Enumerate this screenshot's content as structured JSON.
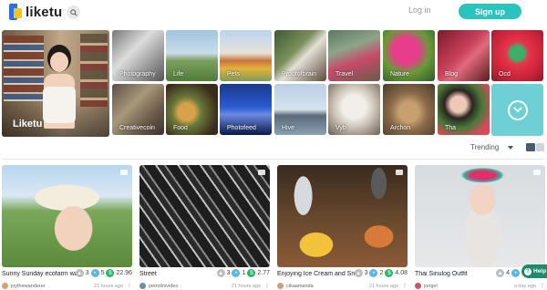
{
  "header": {
    "brand": "liketu",
    "login_label": "Log in",
    "signup_label": "Sign up"
  },
  "hero": {
    "label": "Liketu"
  },
  "categories": [
    {
      "label": "Photography"
    },
    {
      "label": "Life"
    },
    {
      "label": "Pets"
    },
    {
      "label": "Proofofbrain"
    },
    {
      "label": "Travel"
    },
    {
      "label": "Nature"
    },
    {
      "label": "Blog"
    },
    {
      "label": "Ocd"
    },
    {
      "label": "Creativecoin"
    },
    {
      "label": "Food"
    },
    {
      "label": "Photofeed"
    },
    {
      "label": "Hive"
    },
    {
      "label": "Vyb"
    },
    {
      "label": "Archon"
    },
    {
      "label": "Tha"
    }
  ],
  "sort": {
    "selected": "Trending"
  },
  "posts": [
    {
      "title": "Sunny Sunday ecofarm walk",
      "upvotes": "3",
      "comments": "5",
      "payout": "22.96",
      "author": "joythewanderer",
      "time": "21 hours ago"
    },
    {
      "title": "Street",
      "upvotes": "3",
      "comments": "1",
      "payout": "2.77",
      "author": "petrolinivideo",
      "time": "21 hours ago"
    },
    {
      "title": "Enjoying Ice Cream and Snack…",
      "upvotes": "3",
      "comments": "2",
      "payout": "4.08",
      "author": "cikaamanda",
      "time": "21 hours ago"
    },
    {
      "title": "Thai Sinulog Outfit",
      "upvotes": "4",
      "comments": "",
      "payout": "",
      "author": "jongol",
      "time": "a day ago"
    }
  ],
  "help": {
    "label": "Help"
  },
  "colors": {
    "accent": "#2bc3bd",
    "coin": "#2db36b",
    "comment": "#5db7e2",
    "help": "#1e8a6b"
  }
}
